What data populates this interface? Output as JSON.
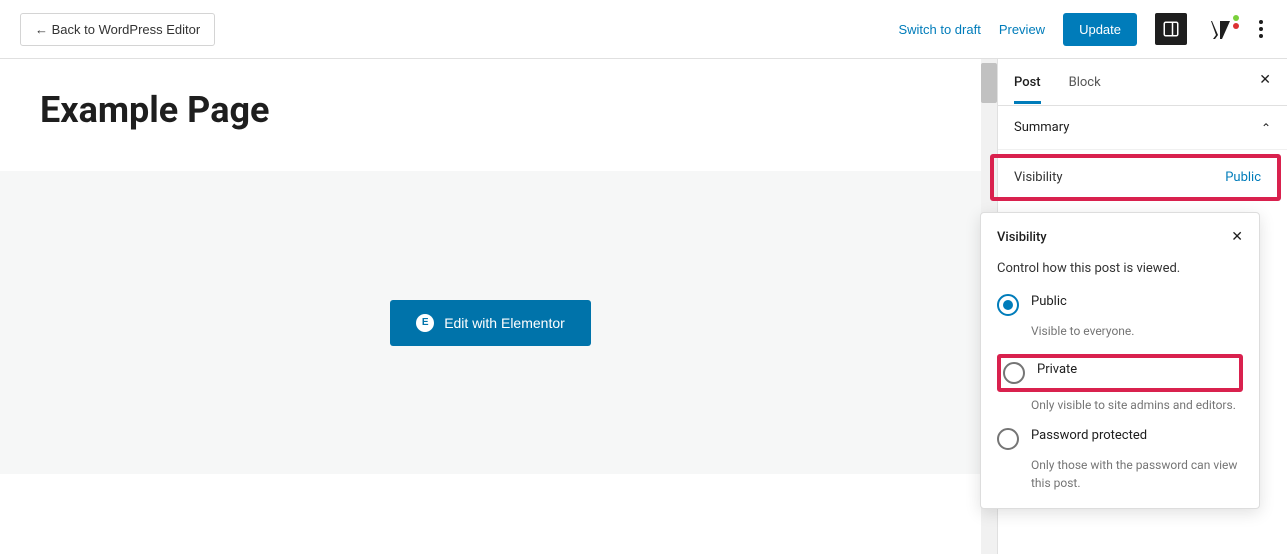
{
  "header": {
    "back_label": "← Back to WordPress Editor",
    "switch_draft": "Switch to draft",
    "preview": "Preview",
    "update": "Update"
  },
  "page": {
    "title": "Example Page",
    "elementor_btn": "Edit with Elementor"
  },
  "sidebar": {
    "tabs": {
      "post": "Post",
      "block": "Block"
    },
    "summary_label": "Summary",
    "visibility_row": {
      "label": "Visibility",
      "value": "Public"
    }
  },
  "popover": {
    "title": "Visibility",
    "description": "Control how this post is viewed.",
    "options": [
      {
        "label": "Public",
        "desc": "Visible to everyone.",
        "selected": true
      },
      {
        "label": "Private",
        "desc": "Only visible to site admins and editors.",
        "selected": false
      },
      {
        "label": "Password protected",
        "desc": "Only those with the password can view this post.",
        "selected": false
      }
    ]
  }
}
